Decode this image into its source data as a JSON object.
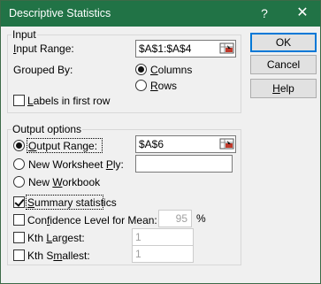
{
  "window": {
    "title": "Descriptive Statistics",
    "help_glyph": "?",
    "close_glyph": "✕"
  },
  "input": {
    "group_label": "Input",
    "input_range_label": "Input Range:",
    "input_range_value": "$A$1:$A$4",
    "grouped_by_label": "Grouped By:",
    "columns_label": "Columns",
    "rows_label": "Rows",
    "grouped_by_selected": "Columns",
    "labels_first_row_label": "Labels in first row",
    "labels_first_row_checked": false
  },
  "output": {
    "group_label": "Output options",
    "output_range_label": "Output Range:",
    "output_range_value": "$A$6",
    "new_worksheet_label": "New Worksheet Ply:",
    "new_worksheet_value": "",
    "new_workbook_label": "New Workbook",
    "selected": "Output Range",
    "summary_label": "Summary statistics",
    "summary_checked": true,
    "confidence_label": "Confidence Level for Mean:",
    "confidence_value": "95",
    "confidence_unit": "%",
    "confidence_checked": false,
    "kth_largest_label": "Kth Largest:",
    "kth_largest_value": "1",
    "kth_largest_checked": false,
    "kth_smallest_label": "Kth Smallest:",
    "kth_smallest_value": "1",
    "kth_smallest_checked": false
  },
  "buttons": {
    "ok": "OK",
    "cancel": "Cancel",
    "help": "Help"
  },
  "icons": {
    "range_selector": "range-select-icon"
  },
  "colors": {
    "titlebar": "#217346",
    "default_button_border": "#0078d7"
  }
}
